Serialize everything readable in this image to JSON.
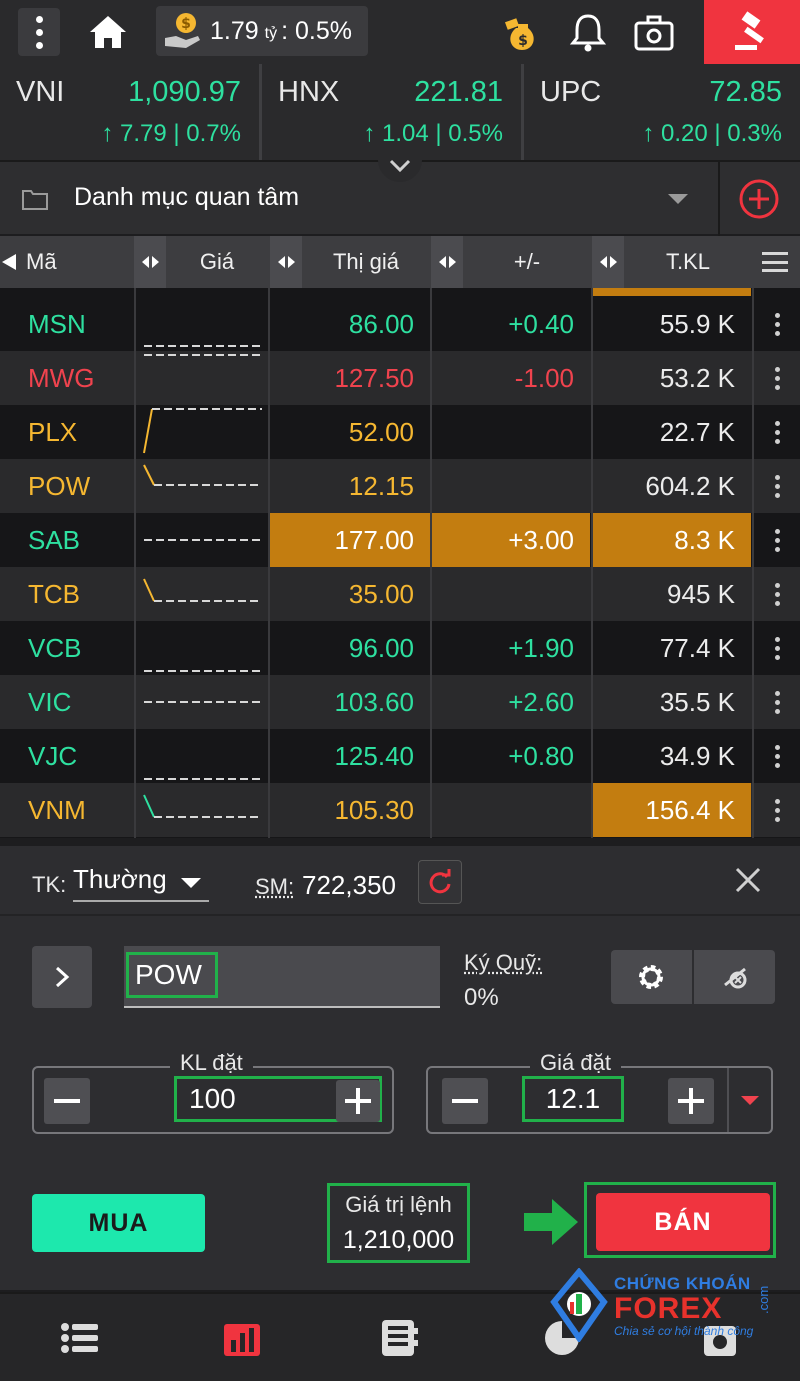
{
  "topbar": {
    "balance_value": "1.79",
    "balance_unit": "tỷ",
    "balance_rate": ": 0.5%"
  },
  "indexes": [
    {
      "name": "VNI",
      "value": "1,090.97",
      "change": "↑ 7.79 | 0.7%"
    },
    {
      "name": "HNX",
      "value": "221.81",
      "change": "↑ 1.04 | 0.5%"
    },
    {
      "name": "UPC",
      "value": "72.85",
      "change": "↑ 0.20 | 0.3%"
    }
  ],
  "watchlist": {
    "title": "Danh mục quan tâm"
  },
  "table": {
    "headers": {
      "symbol": "Mã",
      "price": "Giá",
      "market_price": "Thị giá",
      "change": "+/-",
      "volume": "T.KL"
    },
    "rows": [
      {
        "symbol": "MSN",
        "price": "86.00",
        "change": "+0.40",
        "volume": "55.9 K",
        "color": "green"
      },
      {
        "symbol": "MWG",
        "price": "127.50",
        "change": "-1.00",
        "volume": "53.2 K",
        "color": "red"
      },
      {
        "symbol": "PLX",
        "price": "52.00",
        "change": "",
        "volume": "22.7 K",
        "color": "yellow"
      },
      {
        "symbol": "POW",
        "price": "12.15",
        "change": "",
        "volume": "604.2 K",
        "color": "yellow"
      },
      {
        "symbol": "SAB",
        "price": "177.00",
        "change": "+3.00",
        "volume": "8.3 K",
        "color": "green"
      },
      {
        "symbol": "TCB",
        "price": "35.00",
        "change": "",
        "volume": "945 K",
        "color": "yellow"
      },
      {
        "symbol": "VCB",
        "price": "96.00",
        "change": "+1.90",
        "volume": "77.4 K",
        "color": "green"
      },
      {
        "symbol": "VIC",
        "price": "103.60",
        "change": "+2.60",
        "volume": "35.5 K",
        "color": "green"
      },
      {
        "symbol": "VJC",
        "price": "125.40",
        "change": "+0.80",
        "volume": "34.9 K",
        "color": "green"
      },
      {
        "symbol": "VNM",
        "price": "105.30",
        "change": "",
        "volume": "156.4 K",
        "color": "yellow"
      }
    ]
  },
  "order": {
    "account_label": "TK:",
    "account_value": "Thường",
    "purchasing_label": "SM:",
    "purchasing_value": "722,350",
    "symbol": "POW",
    "margin_label": "Ký Quỹ:",
    "margin_value": "0%",
    "quantity_label": "KL đặt",
    "quantity_value": "100",
    "price_label": "Giá đặt",
    "price_value": "12.1",
    "buy_label": "MUA",
    "order_value_label": "Giá trị lệnh",
    "order_value": "1,210,000",
    "sell_label": "BÁN"
  },
  "watermark": {
    "title": "CHỨNG KHOÁN",
    "brand": "FOREX",
    "suffix": ".com",
    "tagline": "Chia sẻ cơ hội thành công"
  },
  "colors": {
    "green": "#2ee0a0",
    "red": "#f0434e",
    "yellow": "#f5b731",
    "highlight": "#c37d10",
    "buy": "#1de8ad",
    "sell": "#f0343f"
  }
}
